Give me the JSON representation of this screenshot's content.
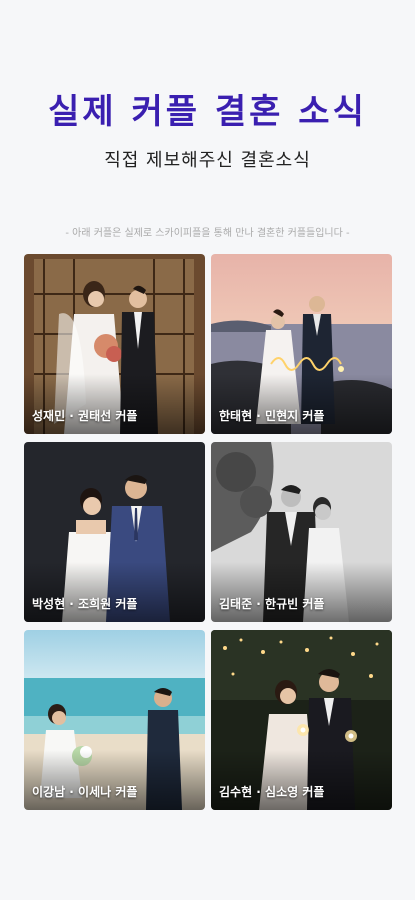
{
  "header": {
    "title": "실제 커플 결혼 소식",
    "subtitle": "직접 제보해주신 결혼소식",
    "note": "- 아래 커플은 실제로 스카이피플을 통해 만나 결혼한 커플들입니다 -"
  },
  "couples": [
    {
      "caption": "성재민 · 권태선 커플"
    },
    {
      "caption": "한태현 · 민현지 커플"
    },
    {
      "caption": "박성현 · 조희원 커플"
    },
    {
      "caption": "김태준 · 한규빈 커플"
    },
    {
      "caption": "이강남 · 이세나 커플"
    },
    {
      "caption": "김수현 · 심소영 커플"
    }
  ]
}
